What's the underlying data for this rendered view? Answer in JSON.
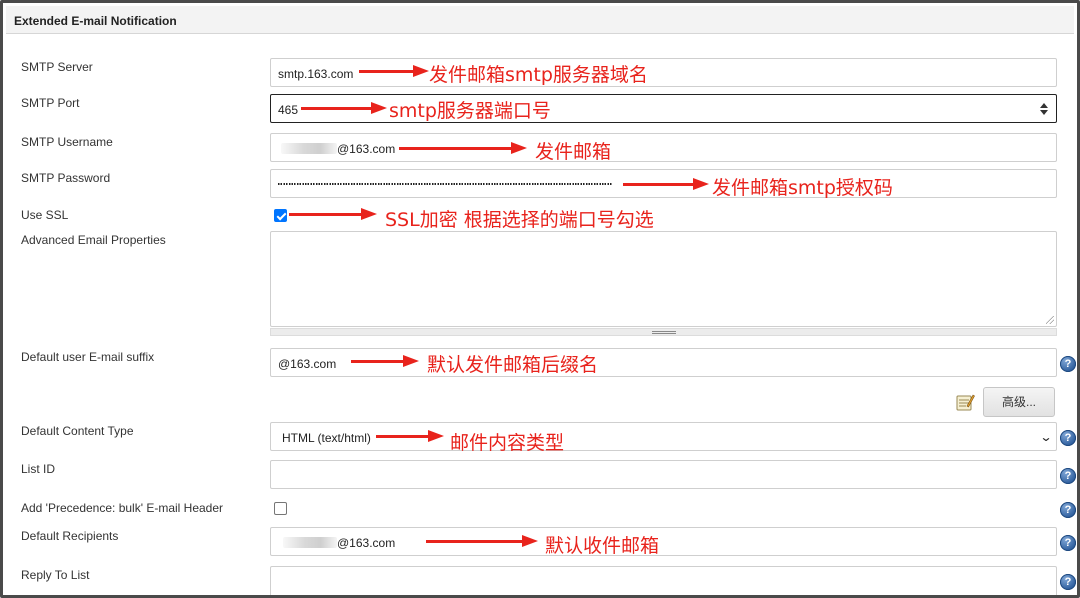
{
  "section": {
    "title": "Extended E-mail Notification"
  },
  "fields": {
    "smtp_server": {
      "label": "SMTP Server",
      "value": "smtp.163.com"
    },
    "smtp_port": {
      "label": "SMTP Port",
      "value": "465"
    },
    "smtp_username": {
      "label": "SMTP Username",
      "value": "@163.com"
    },
    "smtp_password": {
      "label": "SMTP Password"
    },
    "use_ssl": {
      "label": "Use SSL",
      "checked": true
    },
    "advanced_email_properties": {
      "label": "Advanced Email Properties",
      "value": ""
    },
    "default_suffix": {
      "label": "Default user E-mail suffix",
      "value": "@163.com"
    },
    "advanced_button": {
      "label": "高级..."
    },
    "default_content_type": {
      "label": "Default Content Type",
      "selected": "HTML (text/html)"
    },
    "list_id": {
      "label": "List ID",
      "value": ""
    },
    "precedence_bulk": {
      "label": "Add 'Precedence: bulk' E-mail Header",
      "checked": false
    },
    "default_recipients": {
      "label": "Default Recipients",
      "value": "@163.com"
    },
    "reply_to_list": {
      "label": "Reply To List",
      "value": ""
    }
  },
  "annotations": {
    "smtp_server": "发件邮箱smtp服务器域名",
    "smtp_port": "smtp服务器端口号",
    "smtp_username": "发件邮箱",
    "smtp_password": "发件邮箱smtp授权码",
    "use_ssl": "SSL加密 根据选择的端口号勾选",
    "default_suffix": "默认发件邮箱后缀名",
    "default_content_type": "邮件内容类型",
    "default_recipients": "默认收件邮箱"
  },
  "icons": {
    "help": "question-mark-help-icon",
    "notepad": "notepad-icon",
    "select_chevron": "chevron-down-icon",
    "spinner": "spinner-updown-icon"
  },
  "colors": {
    "annotation_red": "#e8231c",
    "checkbox_blue": "#0075ff",
    "help_blue": "#2f5f9e"
  }
}
